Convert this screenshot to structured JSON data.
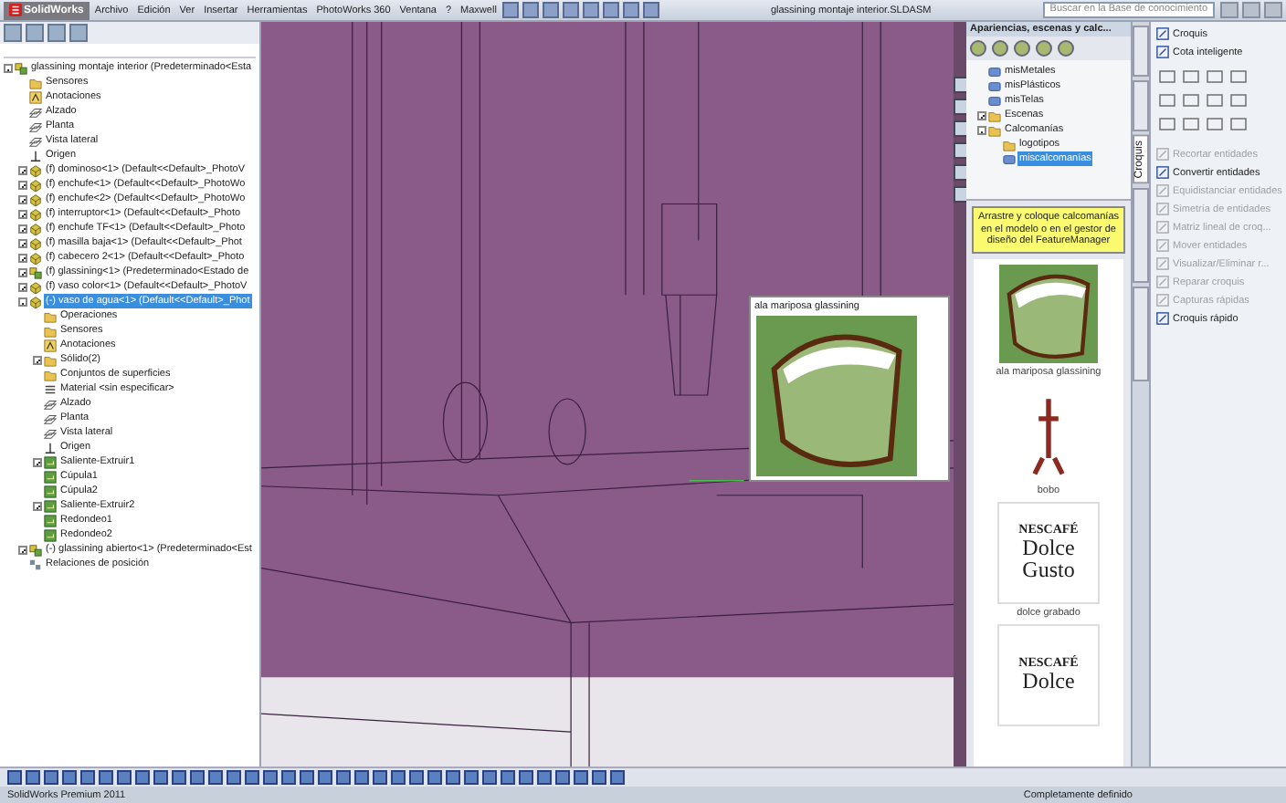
{
  "window": {
    "app_name": "SolidWorks",
    "title": "glassining montaje interior.SLDASM",
    "search_placeholder": "Buscar en la Base de conocimiento"
  },
  "menu": [
    "Archivo",
    "Edición",
    "Ver",
    "Insertar",
    "Herramientas",
    "PhotoWorks 360",
    "Ventana",
    "?",
    "Maxwell"
  ],
  "feature_tree": {
    "items": [
      {
        "label": "glassining montaje interior (Predeterminado<Esta",
        "kind": "assembly",
        "selected": false,
        "expanded": true,
        "children": [
          {
            "label": "Sensores",
            "kind": "folder",
            "selected": false
          },
          {
            "label": "Anotaciones",
            "kind": "annotation",
            "selected": false
          },
          {
            "label": "Alzado",
            "kind": "plane",
            "selected": false
          },
          {
            "label": "Planta",
            "kind": "plane",
            "selected": false
          },
          {
            "label": "Vista lateral",
            "kind": "plane",
            "selected": false
          },
          {
            "label": "Origen",
            "kind": "origin",
            "selected": false
          },
          {
            "label": "(f) dominoso<1> (Default<<Default>_PhotoV",
            "kind": "part",
            "selected": false,
            "expanded": false
          },
          {
            "label": "(f) enchufe<1> (Default<<Default>_PhotoWo",
            "kind": "part",
            "selected": false,
            "expanded": false
          },
          {
            "label": "(f) enchufe<2> (Default<<Default>_PhotoWo",
            "kind": "part",
            "selected": false,
            "expanded": false
          },
          {
            "label": "(f) interruptor<1> (Default<<Default>_Photo",
            "kind": "part",
            "selected": false,
            "expanded": false
          },
          {
            "label": "(f) enchufe TF<1> (Default<<Default>_Photo",
            "kind": "part",
            "selected": false,
            "expanded": false
          },
          {
            "label": "(f) masilla baja<1> (Default<<Default>_Phot",
            "kind": "part",
            "selected": false,
            "expanded": false
          },
          {
            "label": "(f) cabecero 2<1> (Default<<Default>_Photo",
            "kind": "part",
            "selected": false,
            "expanded": false
          },
          {
            "label": "(f) glassining<1> (Predeterminado<Estado de",
            "kind": "subassembly",
            "selected": false,
            "expanded": false
          },
          {
            "label": "(f) vaso color<1> (Default<<Default>_PhotoV",
            "kind": "part",
            "selected": false,
            "expanded": false
          },
          {
            "label": "(-) vaso de agua<1> (Default<<Default>_Phot",
            "kind": "part",
            "selected": true,
            "expanded": true,
            "children": [
              {
                "label": "Operaciones",
                "kind": "folder",
                "selected": false
              },
              {
                "label": "Sensores",
                "kind": "folder",
                "selected": false
              },
              {
                "label": "Anotaciones",
                "kind": "annotation",
                "selected": false
              },
              {
                "label": "Sólido(2)",
                "kind": "folder",
                "selected": false,
                "expanded": false
              },
              {
                "label": "Conjuntos de superficies",
                "kind": "folder",
                "selected": false
              },
              {
                "label": "Material <sin especificar>",
                "kind": "material",
                "selected": false
              },
              {
                "label": "Alzado",
                "kind": "plane",
                "selected": false
              },
              {
                "label": "Planta",
                "kind": "plane",
                "selected": false
              },
              {
                "label": "Vista lateral",
                "kind": "plane",
                "selected": false
              },
              {
                "label": "Origen",
                "kind": "origin",
                "selected": false
              },
              {
                "label": "Saliente-Extruir1",
                "kind": "feature",
                "selected": false,
                "expanded": false
              },
              {
                "label": "Cúpula1",
                "kind": "feature",
                "selected": false
              },
              {
                "label": "Cúpula2",
                "kind": "feature",
                "selected": false
              },
              {
                "label": "Saliente-Extruir2",
                "kind": "feature",
                "selected": false,
                "expanded": false
              },
              {
                "label": "Redondeo1",
                "kind": "feature",
                "selected": false
              },
              {
                "label": "Redondeo2",
                "kind": "feature",
                "selected": false
              }
            ]
          },
          {
            "label": "(-) glassining abierto<1> (Predeterminado<Est",
            "kind": "subassembly",
            "selected": false,
            "expanded": false
          },
          {
            "label": "Relaciones de posición",
            "kind": "mates",
            "selected": false
          }
        ]
      }
    ]
  },
  "viewport": {
    "tooltip": {
      "title": "ala mariposa glassining"
    }
  },
  "task_pane": {
    "title": "Apariencias, escenas y calc...",
    "tree": [
      {
        "label": "misMetales",
        "kind": "library",
        "selected": false
      },
      {
        "label": "misPlásticos",
        "kind": "library",
        "selected": false
      },
      {
        "label": "misTelas",
        "kind": "library",
        "selected": false
      },
      {
        "label": "Escenas",
        "kind": "folder",
        "selected": false,
        "expanded": false
      },
      {
        "label": "Calcomanías",
        "kind": "folder",
        "selected": false,
        "expanded": true,
        "children": [
          {
            "label": "logotipos",
            "kind": "folder",
            "selected": false
          },
          {
            "label": "miscalcomanías",
            "kind": "library",
            "selected": true
          }
        ]
      }
    ],
    "hint": "Arrastre y coloque calcomanías en el modelo o en el gestor de diseño del FeatureManager",
    "thumbnails": [
      {
        "kind": "photo",
        "caption": "ala mariposa glassining"
      },
      {
        "kind": "figure",
        "caption": "bobo"
      },
      {
        "kind": "logo",
        "logo_lines": [
          "NESCAFÉ",
          "Dolce",
          "Gusto"
        ],
        "caption": "dolce grabado"
      },
      {
        "kind": "logo",
        "logo_lines": [
          "NESCAFÉ",
          "Dolce"
        ]
      }
    ]
  },
  "command_manager": {
    "tab": "Croquis",
    "tools": [
      {
        "label": "Croquis",
        "disabled": false
      },
      {
        "label": "Cota inteligente",
        "disabled": false
      },
      {
        "label": "Recortar entidades",
        "disabled": true
      },
      {
        "label": "Convertir entidades",
        "disabled": false
      },
      {
        "label": "Equidistanciar entidades",
        "disabled": true
      },
      {
        "label": "Simetría de entidades",
        "disabled": true
      },
      {
        "label": "Matriz lineal de croq...",
        "disabled": true
      },
      {
        "label": "Mover entidades",
        "disabled": true
      },
      {
        "label": "Visualizar/Eliminar r...",
        "disabled": true
      },
      {
        "label": "Reparar croquis",
        "disabled": true
      },
      {
        "label": "Capturas rápidas",
        "disabled": true
      },
      {
        "label": "Croquis rápido",
        "disabled": false
      }
    ]
  },
  "status_bar": {
    "product": "SolidWorks Premium 2011",
    "state": "Completamente definido"
  }
}
